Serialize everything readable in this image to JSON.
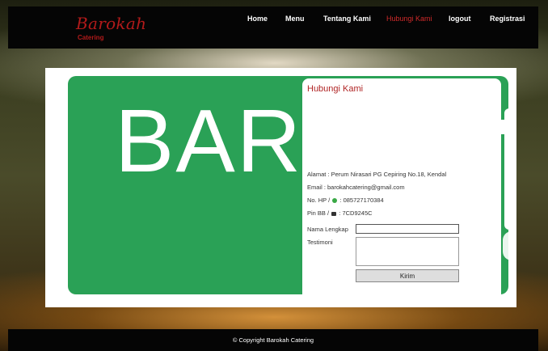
{
  "brand": {
    "name": "Barokah",
    "tagline": "Catering"
  },
  "nav": [
    {
      "label": "Home"
    },
    {
      "label": "Menu"
    },
    {
      "label": "Tentang Kami"
    },
    {
      "label": "Hubungi Kami",
      "active": true
    },
    {
      "label": "logout"
    },
    {
      "label": "Registrasi"
    }
  ],
  "banner": {
    "text": "BAR"
  },
  "contact": {
    "title": "Hubungi Kami",
    "address": "Alamat : Perum Nirasari PG Cepiring No.18, Kendal",
    "email": "Email : barokahcatering@gmail.com",
    "phone_prefix": "No. HP /",
    "phone_value": ": 085727170384",
    "pin_prefix": "Pin BB /",
    "pin_value": ": 7CD9245C"
  },
  "form": {
    "name_label": "Nama Lengkap",
    "name_value": "",
    "testimoni_label": "Testimoni",
    "testimoni_value": "",
    "submit_label": "Kirim"
  },
  "footer": {
    "text": "© Copyright Barokah Catering"
  },
  "colors": {
    "brand_red": "#b21a1a",
    "nav_active": "#d02a2a",
    "banner_green": "#2aa156"
  }
}
